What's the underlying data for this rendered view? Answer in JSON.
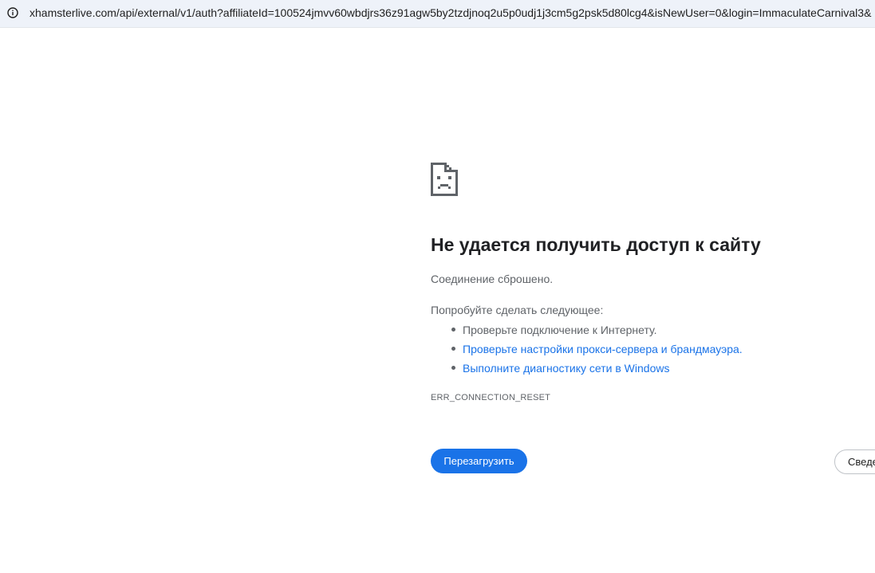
{
  "address_bar": {
    "url": "xhamsterlive.com/api/external/v1/auth?affiliateId=100524jmvv60wbdjrs36z91agw5by2tzdjnoq2u5p0udj1j3cm5g2psk5d80lcg4&isNewUser=0&login=ImmaculateCarnival3&",
    "icon": "info-icon"
  },
  "error_page": {
    "icon": "sad-page-icon",
    "heading": "Не удается получить доступ к сайту",
    "subtitle": "Соединение сброшено.",
    "try_label": "Попробуйте сделать следующее:",
    "suggestions": [
      {
        "text": "Проверьте подключение к Интернету.",
        "is_link": false
      },
      {
        "text": "Проверьте настройки прокси-сервера и брандмауэра.",
        "is_link": true
      },
      {
        "text": "Выполните диагностику сети в Windows",
        "is_link": true
      }
    ],
    "error_code": "ERR_CONNECTION_RESET",
    "reload_label": "Перезагрузить",
    "details_label": "Сведения"
  },
  "colors": {
    "accent": "#1a73e8",
    "text_primary": "#202124",
    "text_secondary": "#5f6368",
    "url_bar_bg": "#eef2f9"
  }
}
